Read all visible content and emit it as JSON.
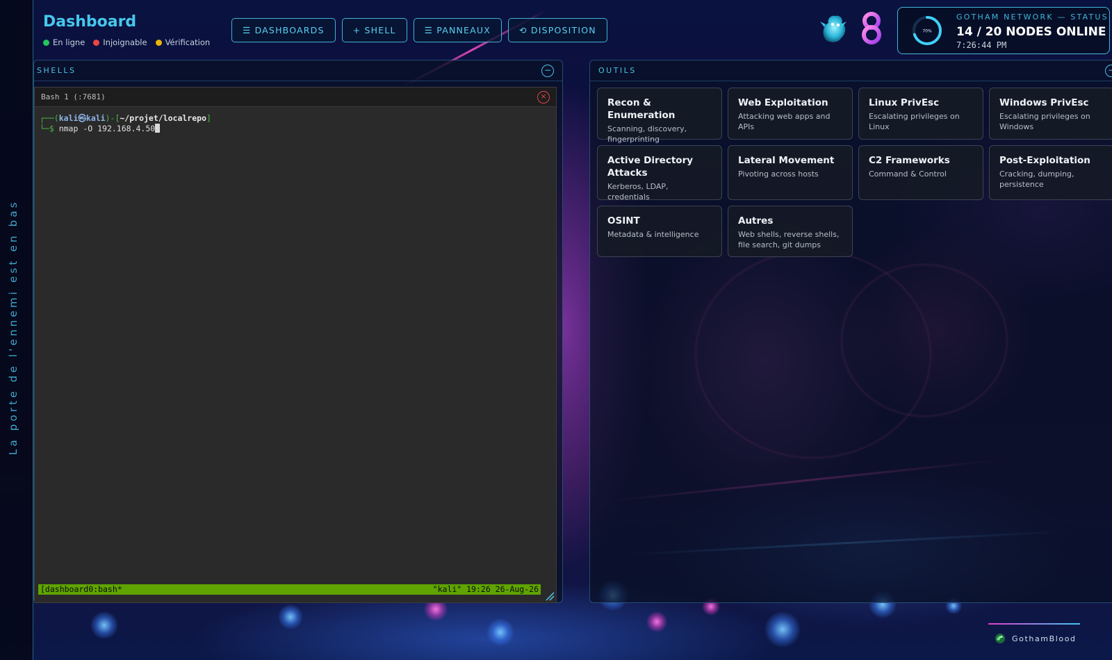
{
  "rail": {
    "text": "La porte de l'ennemi est en bas"
  },
  "header": {
    "title": "Dashboard",
    "legend": [
      {
        "label": "En ligne",
        "color": "#22c55e"
      },
      {
        "label": "Injoignable",
        "color": "#ef4444"
      },
      {
        "label": "Vérification",
        "color": "#eab308"
      }
    ],
    "nav": [
      {
        "label": "☰ DASHBOARDS"
      },
      {
        "label": "+ SHELL"
      },
      {
        "label": "☰ PANNEAUX"
      },
      {
        "label": "⟲ DISPOSITION"
      }
    ]
  },
  "status": {
    "title": "GOTHAM NETWORK — STATUS",
    "nodes": "14 / 20 NODES ONLINE",
    "time": "7:26:44 PM",
    "percent_label": "70%",
    "percent": 70
  },
  "shells": {
    "title": "SHELLS",
    "collapse": "−",
    "terminal": {
      "title": "Bash 1 (:7681)",
      "close": "×",
      "prompt_open": "┌──(",
      "user_host": "kali㉿kali",
      "prompt_mid": ")-[",
      "path": "~/projet/localrepo",
      "prompt_close": "]",
      "prompt2": "└─$ ",
      "command": "nmap -O 192.168.4.50"
    },
    "tmux": {
      "left": "[dashboard0:bash*",
      "right": "\"kali\" 19:26 26-Aug-26"
    }
  },
  "outils": {
    "title": "OUTILS",
    "collapse": "−",
    "tools": [
      {
        "name": "Recon & Enumeration",
        "desc": "Scanning, discovery, fingerprinting"
      },
      {
        "name": "Web Exploitation",
        "desc": "Attacking web apps and APIs"
      },
      {
        "name": "Linux PrivEsc",
        "desc": "Escalating privileges on Linux"
      },
      {
        "name": "Windows PrivEsc",
        "desc": "Escalating privileges on Windows"
      },
      {
        "name": "Active Directory Attacks",
        "desc": "Kerberos, LDAP, credentials"
      },
      {
        "name": "Lateral Movement",
        "desc": "Pivoting across hosts"
      },
      {
        "name": "C2 Frameworks",
        "desc": "Command & Control"
      },
      {
        "name": "Post-Exploitation",
        "desc": "Cracking, dumping, persistence"
      },
      {
        "name": "OSINT",
        "desc": "Metadata & intelligence"
      },
      {
        "name": "Autres",
        "desc": "Web shells, reverse shells, file search, git dumps"
      }
    ]
  },
  "footer": {
    "brand": "GothamBlood"
  }
}
